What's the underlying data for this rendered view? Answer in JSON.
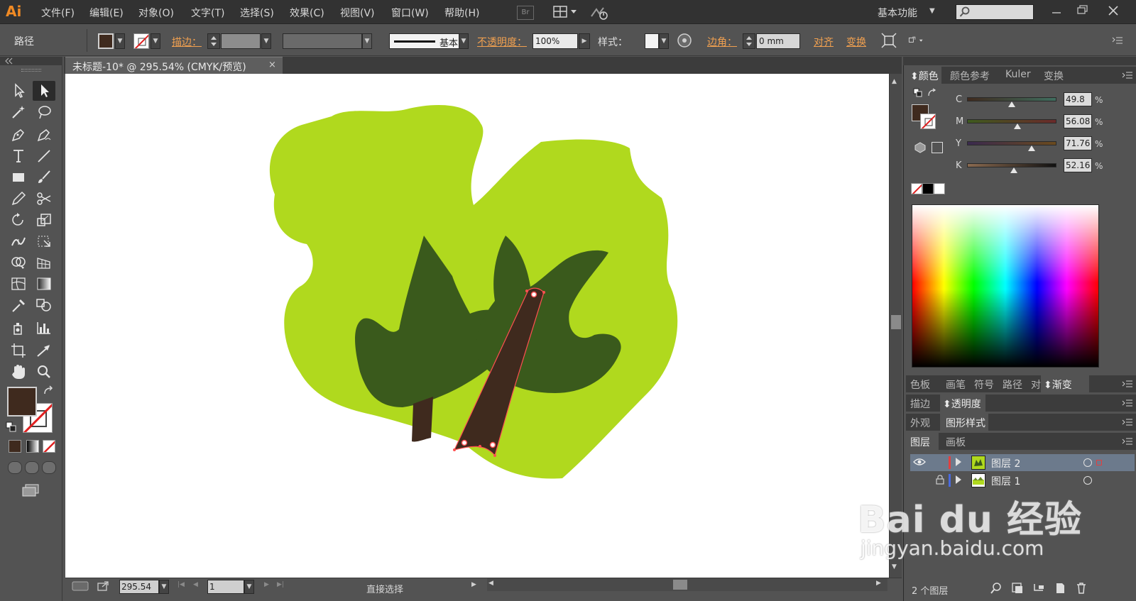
{
  "app": {
    "logo": "Ai",
    "menus": [
      "文件(F)",
      "编辑(E)",
      "对象(O)",
      "文字(T)",
      "选择(S)",
      "效果(C)",
      "视图(V)",
      "窗口(W)",
      "帮助(H)"
    ],
    "bridge_label": "Br",
    "workspace": "基本功能",
    "search_placeholder": ""
  },
  "control_bar": {
    "selection_type": "路径",
    "stroke_label": "描边：",
    "stroke_profile": "基本",
    "opacity_label": "不透明度：",
    "opacity_value": "100%",
    "style_label": "样式：",
    "corner_label": "边角：",
    "corner_value": "0 mm",
    "align_link": "对齐",
    "transform_link": "变换",
    "fill_color": "#3f2a1e"
  },
  "document": {
    "tab_title": "未标题-10* @ 295.54% (CMYK/预览)",
    "close_glyph": "×"
  },
  "status_bar": {
    "zoom": "295.54",
    "page": "1",
    "current_tool": "直接选择"
  },
  "color_panel": {
    "tabs": [
      "颜色",
      "颜色参考",
      "Kuler",
      "变换"
    ],
    "active_tab": "颜色",
    "sliders": [
      {
        "label": "C",
        "value": "49.8",
        "position": 0.49
      },
      {
        "label": "M",
        "value": "56.08",
        "position": 0.56
      },
      {
        "label": "Y",
        "value": "71.76",
        "position": 0.72
      },
      {
        "label": "K",
        "value": "52.16",
        "position": 0.52
      }
    ],
    "percent_sign": "%"
  },
  "panel_groups": {
    "group1_tabs": [
      "色板",
      "画笔",
      "符号",
      "路径",
      "对齐",
      "渐变"
    ],
    "group2_tabs": [
      "描边",
      "透明度"
    ],
    "group3_tabs": [
      "外观",
      "图形样式"
    ],
    "group4_tabs": [
      "图层",
      "画板"
    ]
  },
  "layers": {
    "items": [
      {
        "name": "图层  2",
        "color": "#e04040",
        "selected": true
      },
      {
        "name": "图层  1",
        "color": "#4a6adf",
        "selected": false
      }
    ],
    "count_label": "2 个图层"
  },
  "watermark": {
    "brand": "Bai du 经验",
    "url": "jingyan.baidu.com"
  },
  "artwork_colors": {
    "light_green": "#b0d91e",
    "dark_green": "#3a5a1c",
    "trunk_brown": "#3f2a1e",
    "path_selection": "#ff5050"
  }
}
